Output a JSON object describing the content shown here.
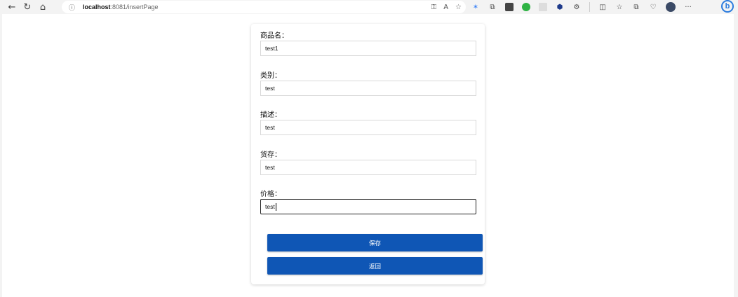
{
  "browser": {
    "address_host": "localhost",
    "address_path": ":8081/insertPage",
    "back_glyph": "←",
    "refresh_glyph": "↻",
    "home_glyph": "⌂",
    "info_glyph": "ⓘ",
    "more_glyph": "···",
    "bing_glyph": "b"
  },
  "form": {
    "fields": [
      {
        "label": "商品名：",
        "value": "test1"
      },
      {
        "label": "类别：",
        "value": "test"
      },
      {
        "label": "描述：",
        "value": "test"
      },
      {
        "label": "货存：",
        "value": "test"
      },
      {
        "label": "价格：",
        "value": "test"
      }
    ],
    "save_label": "保存",
    "back_label": "返回"
  },
  "colors": {
    "primary_button": "#0f56b5"
  }
}
